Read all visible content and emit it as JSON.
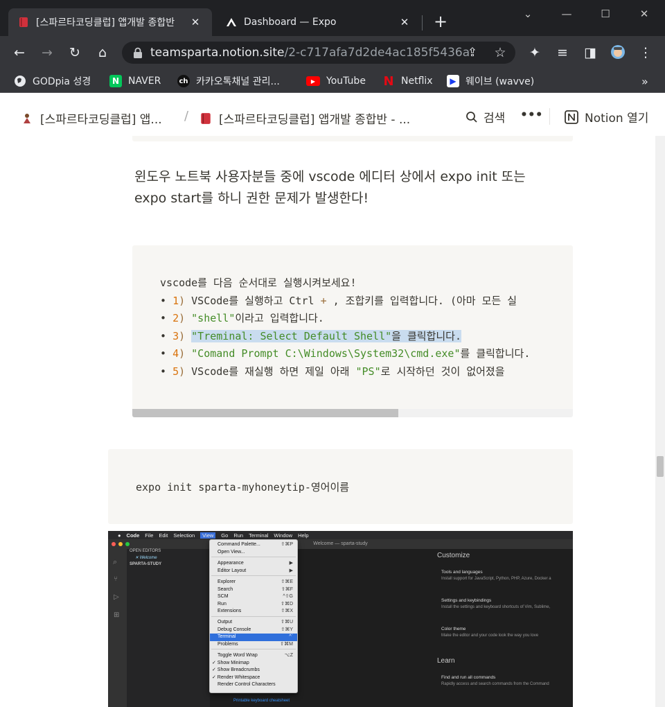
{
  "browser": {
    "tabs": [
      {
        "title": "[스파르타코딩클럽] 앱개발 종합반",
        "active": true
      },
      {
        "title": "Dashboard — Expo",
        "active": false
      }
    ],
    "url_host": "teamsparta.notion.site",
    "url_path": "/2-c717afa7d2de4ac185f5436a...",
    "bookmarks": [
      {
        "label": "GODpia 성경"
      },
      {
        "label": "NAVER"
      },
      {
        "label": "카카오톡채널 관리..."
      },
      {
        "label": "YouTube"
      },
      {
        "label": "Netflix"
      },
      {
        "label": "웨이브 (wavve)"
      }
    ],
    "bookmarks_more": "»"
  },
  "notion": {
    "crumb1": "[스파르타코딩클럽] 앱...",
    "crumb2": "[스파르타코딩클럽] 앱개발 종합반 - ...",
    "search_label": "검색",
    "more_label": "•••",
    "open_label": "Notion 열기"
  },
  "page": {
    "para_line1": "윈도우 노트북 사용자분들 중에 vscode 에디터 상에서 expo init 또는",
    "para_line2": "expo start를 하니 권한 문제가 발생한다!",
    "code_intro": "vscode를 다음 순서대로 실행시켜보세요!",
    "steps": [
      {
        "n": "1",
        "a": "VSCode를 실행하고 Ctrl ",
        "b": "+",
        "c": " , 조합키를 입력합니다. (아마 모든 실"
      },
      {
        "n": "2",
        "s": "\"shell\"",
        "c": "이라고 입력합니다."
      },
      {
        "n": "3",
        "s": "\"Treminal: Select Default Shell\"",
        "c": "을 클릭합니다."
      },
      {
        "n": "4",
        "s": "\"Comand Prompt C:\\Windows\\System32\\cmd.exe\"",
        "c": "를 클릭합니다."
      },
      {
        "n": "5",
        "a": "VScode를 재실행 하면 제일 아래 ",
        "s": "\"PS\"",
        "c": "로 시작하던 것이 없어졌을"
      }
    ],
    "code2": "expo init sparta-myhoneytip-영어이름"
  },
  "screenshot": {
    "menubar": [
      "Code",
      "File",
      "Edit",
      "Selection",
      "View",
      "Go",
      "Run",
      "Terminal",
      "Window",
      "Help"
    ],
    "window_title": "Welcome — sparta-study",
    "sidebar": {
      "open_editors": "OPEN EDITORS",
      "welcome_tab": "Welcome",
      "folder": "SPARTA-STUDY"
    },
    "menu_items": [
      {
        "label": "Command Palette...",
        "sc": "⇧⌘P"
      },
      {
        "label": "Open View...",
        "sc": ""
      },
      {
        "label": "Appearance",
        "sc": "▶"
      },
      {
        "label": "Editor Layout",
        "sc": "▶"
      },
      {
        "label": "Explorer",
        "sc": "⇧⌘E"
      },
      {
        "label": "Search",
        "sc": "⇧⌘F"
      },
      {
        "label": "SCM",
        "sc": "^⇧G"
      },
      {
        "label": "Run",
        "sc": "⇧⌘D"
      },
      {
        "label": "Extensions",
        "sc": "⇧⌘X"
      },
      {
        "label": "Output",
        "sc": "⇧⌘U"
      },
      {
        "label": "Debug Console",
        "sc": "⇧⌘Y"
      },
      {
        "label": "Terminal",
        "sc": "^`",
        "selected": true
      },
      {
        "label": "Problems",
        "sc": "⇧⌘M"
      },
      {
        "label": "Toggle Word Wrap",
        "sc": "⌥Z"
      },
      {
        "label": "✓ Show Minimap",
        "sc": ""
      },
      {
        "label": "✓ Show Breadcrumbs",
        "sc": ""
      },
      {
        "label": "✓ Render Whitespace",
        "sc": ""
      },
      {
        "label": "Render Control Characters",
        "sc": ""
      }
    ],
    "customize": "Customize",
    "tools_title": "Tools and languages",
    "tools_desc": "Install support for JavaScript, Python, PHP, Azure, Docker a",
    "settings_title": "Settings and keybindings",
    "settings_desc": "Install the settings and keyboard shortcuts of Vim, Sublime,",
    "theme_title": "Color theme",
    "theme_desc": "Make the editor and your code look the way you love",
    "learn": "Learn",
    "find_title": "Find and run all commands",
    "find_desc": "Rapidly access and search commands from the Command",
    "cheatsheet": "Printable keyboard cheatsheet"
  }
}
